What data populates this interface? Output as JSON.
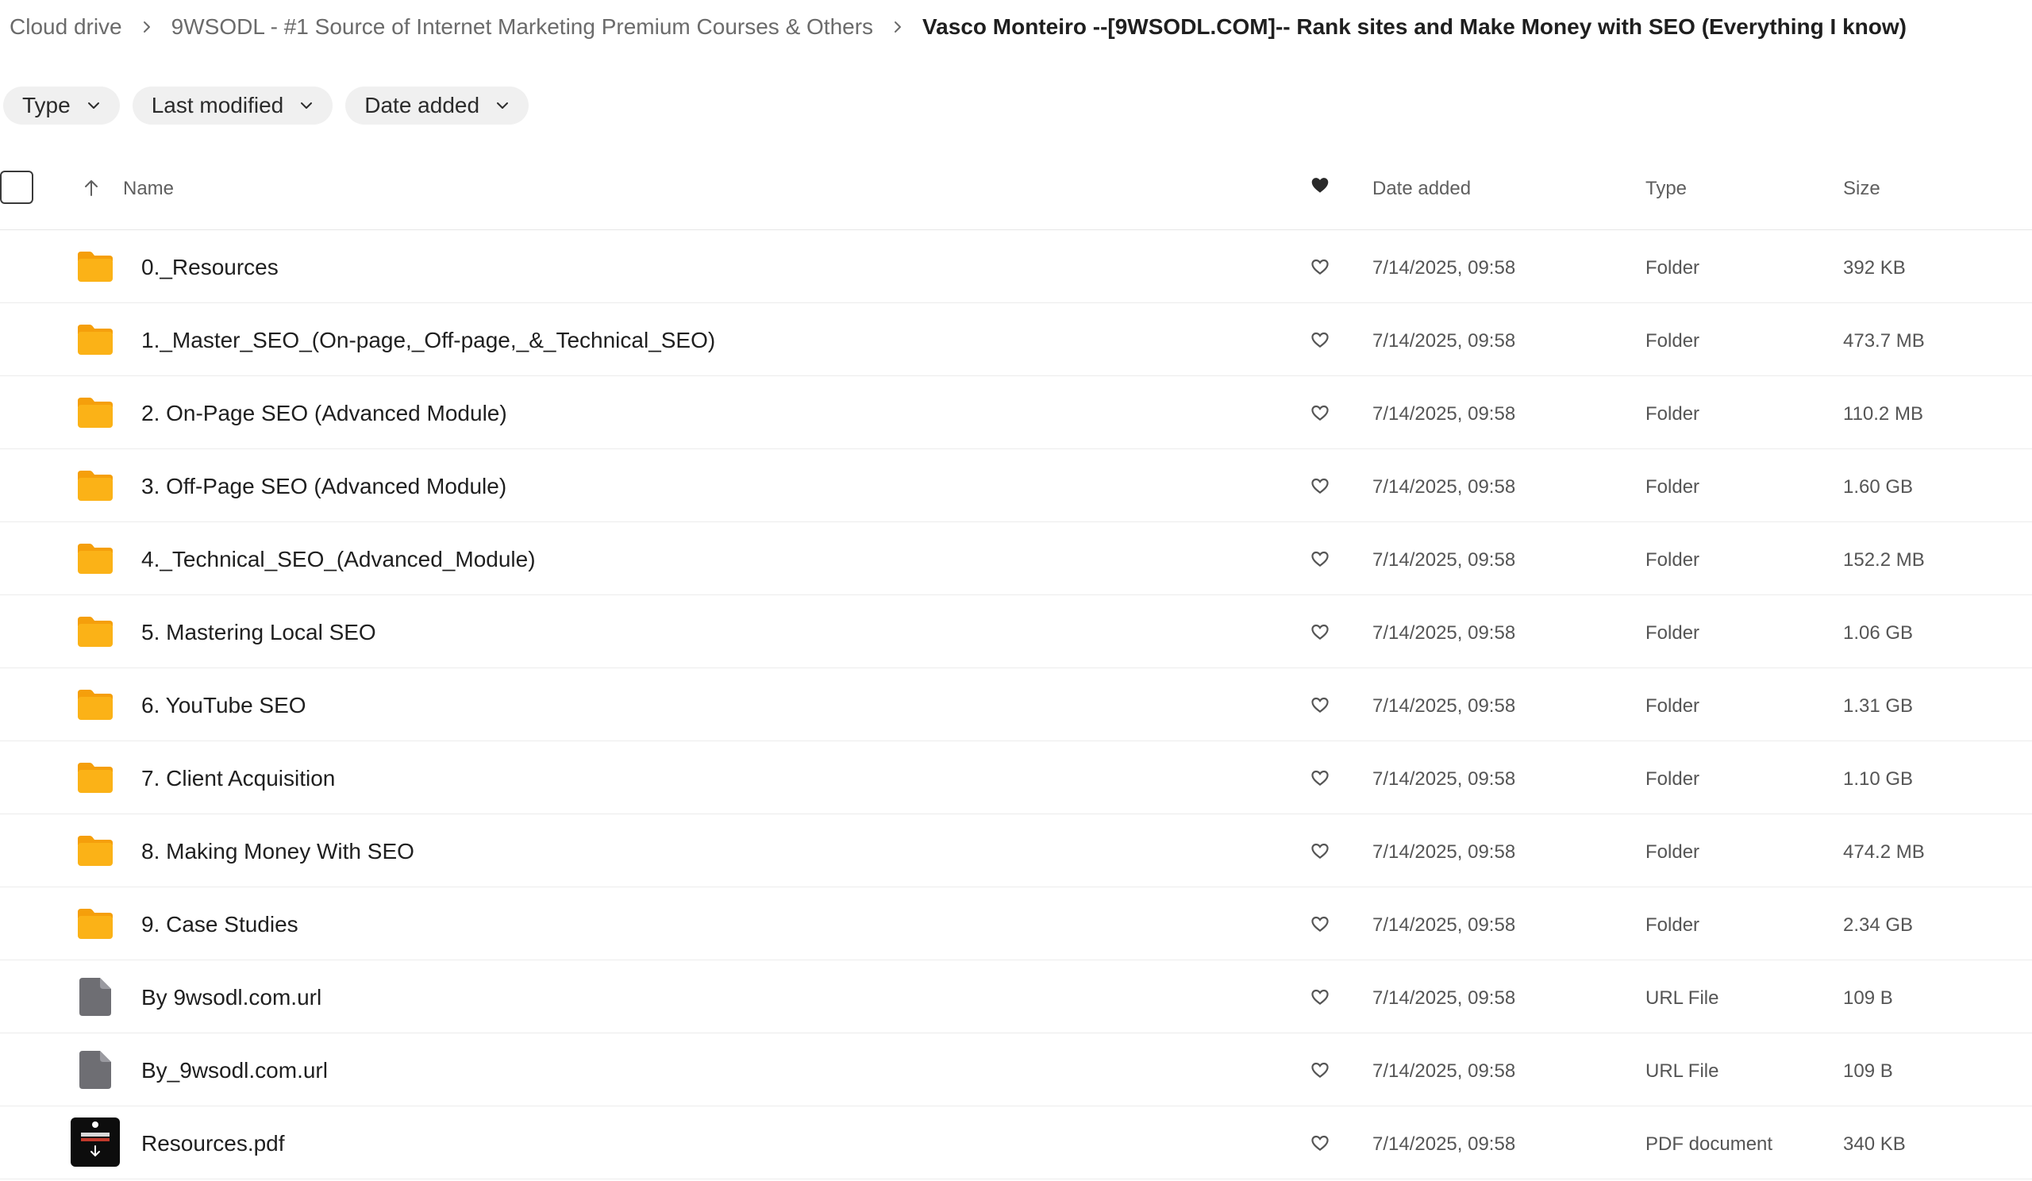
{
  "breadcrumb": [
    {
      "label": "Cloud drive"
    },
    {
      "label": "9WSODL - #1 Source of Internet Marketing Premium Courses & Others"
    },
    {
      "label": "Vasco Monteiro --[9WSODL.COM]-- Rank sites and Make Money with SEO (Everything I know)"
    }
  ],
  "filters": [
    "Type",
    "Last modified",
    "Date added"
  ],
  "table": {
    "headers": {
      "name": "Name",
      "date": "Date added",
      "type": "Type",
      "size": "Size"
    },
    "rows": [
      {
        "name": "0._Resources",
        "date": "7/14/2025, 09:58",
        "type": "Folder",
        "size": "392 KB",
        "icon": "folder-icon"
      },
      {
        "name": "1._Master_SEO_(On-page,_Off-page,_&_Technical_SEO)",
        "date": "7/14/2025, 09:58",
        "type": "Folder",
        "size": "473.7 MB",
        "icon": "folder-icon"
      },
      {
        "name": "2. On-Page SEO (Advanced Module)",
        "date": "7/14/2025, 09:58",
        "type": "Folder",
        "size": "110.2 MB",
        "icon": "folder-icon"
      },
      {
        "name": "3. Off-Page SEO (Advanced Module)",
        "date": "7/14/2025, 09:58",
        "type": "Folder",
        "size": "1.60 GB",
        "icon": "folder-icon"
      },
      {
        "name": "4._Technical_SEO_(Advanced_Module)",
        "date": "7/14/2025, 09:58",
        "type": "Folder",
        "size": "152.2 MB",
        "icon": "folder-icon"
      },
      {
        "name": "5. Mastering Local SEO",
        "date": "7/14/2025, 09:58",
        "type": "Folder",
        "size": "1.06 GB",
        "icon": "folder-icon"
      },
      {
        "name": "6. YouTube SEO",
        "date": "7/14/2025, 09:58",
        "type": "Folder",
        "size": "1.31 GB",
        "icon": "folder-icon"
      },
      {
        "name": "7. Client Acquisition",
        "date": "7/14/2025, 09:58",
        "type": "Folder",
        "size": "1.10 GB",
        "icon": "folder-icon"
      },
      {
        "name": "8. Making Money With SEO",
        "date": "7/14/2025, 09:58",
        "type": "Folder",
        "size": "474.2 MB",
        "icon": "folder-icon"
      },
      {
        "name": "9. Case Studies",
        "date": "7/14/2025, 09:58",
        "type": "Folder",
        "size": "2.34 GB",
        "icon": "folder-icon"
      },
      {
        "name": "By 9wsodl.com.url",
        "date": "7/14/2025, 09:58",
        "type": "URL File",
        "size": "109 B",
        "icon": "file-icon"
      },
      {
        "name": "By_9wsodl.com.url",
        "date": "7/14/2025, 09:58",
        "type": "URL File",
        "size": "109 B",
        "icon": "file-icon"
      },
      {
        "name": "Resources.pdf",
        "date": "7/14/2025, 09:58",
        "type": "PDF document",
        "size": "340 KB",
        "icon": "pdf-thumbnail-icon"
      }
    ]
  },
  "colors": {
    "folder": "#fbb217",
    "folder_back": "#f59f0b",
    "file": "#6e6e73",
    "text": "#1f1f1f",
    "muted": "#6b6b6b",
    "chip_bg": "#f0f0f0"
  }
}
